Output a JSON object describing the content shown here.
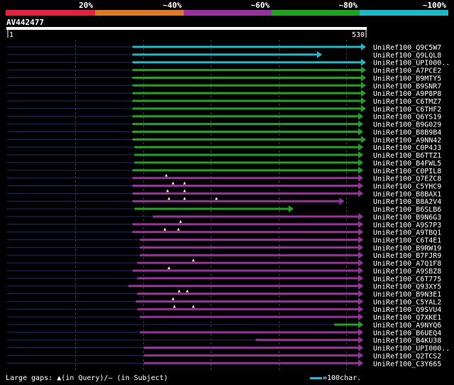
{
  "chart_data": {
    "type": "alignment-overview",
    "title": "AV442477",
    "query_length": 530,
    "query_ticks": [
      "1",
      "530"
    ],
    "identity_legend": [
      {
        "label": "20%",
        "color": "#e8213f"
      },
      {
        "label": "~40%",
        "color": "#e07a22"
      },
      {
        "label": "~60%",
        "color": "#9a2fa0"
      },
      {
        "label": "~80%",
        "color": "#1ea51e"
      },
      {
        "label": "~100%",
        "color": "#1cb8c8"
      }
    ],
    "hits": [
      {
        "name": "UniRef100_Q9C5W7",
        "start": 185,
        "end": 530,
        "color": "#1cb8c8",
        "gaps": []
      },
      {
        "name": "UniRef100_Q9LQL8",
        "start": 185,
        "end": 465,
        "color": "#1cb8c8",
        "gaps": []
      },
      {
        "name": "UniRef100_UPI000..",
        "start": 185,
        "end": 530,
        "color": "#1cb8c8",
        "gaps": []
      },
      {
        "name": "UniRef100_A7PCE2",
        "start": 185,
        "end": 530,
        "color": "#1ea51e",
        "gaps": []
      },
      {
        "name": "UniRef100_B9MTY5",
        "start": 185,
        "end": 530,
        "color": "#1ea51e",
        "gaps": []
      },
      {
        "name": "UniRef100_B9SNR7",
        "start": 185,
        "end": 530,
        "color": "#1ea51e",
        "gaps": []
      },
      {
        "name": "UniRef100_A9P8P8",
        "start": 185,
        "end": 530,
        "color": "#1ea51e",
        "gaps": []
      },
      {
        "name": "UniRef100_C6TMZ7",
        "start": 185,
        "end": 530,
        "color": "#1ea51e",
        "gaps": []
      },
      {
        "name": "UniRef100_C6THF2",
        "start": 185,
        "end": 530,
        "color": "#1ea51e",
        "gaps": []
      },
      {
        "name": "UniRef100_Q6YS19",
        "start": 185,
        "end": 526,
        "color": "#1ea51e",
        "gaps": []
      },
      {
        "name": "UniRef100_B9G029",
        "start": 185,
        "end": 526,
        "color": "#1ea51e",
        "gaps": []
      },
      {
        "name": "UniRef100_B8B9B4",
        "start": 185,
        "end": 526,
        "color": "#1ea51e",
        "gaps": []
      },
      {
        "name": "UniRef100_A9NN42",
        "start": 185,
        "end": 530,
        "color": "#1ea51e",
        "gaps": []
      },
      {
        "name": "UniRef100_C0P4J3",
        "start": 188,
        "end": 526,
        "color": "#1ea51e",
        "gaps": []
      },
      {
        "name": "UniRef100_B6TTZ1",
        "start": 188,
        "end": 526,
        "color": "#1ea51e",
        "gaps": []
      },
      {
        "name": "UniRef100_B4FWL5",
        "start": 188,
        "end": 526,
        "color": "#1ea51e",
        "gaps": []
      },
      {
        "name": "UniRef100_C0PIL8",
        "start": 185,
        "end": 526,
        "color": "#1ea51e",
        "gaps": []
      },
      {
        "name": "UniRef100_Q7EZC8",
        "start": 185,
        "end": 526,
        "color": "#9a2fa0",
        "gaps": [
          235
        ]
      },
      {
        "name": "UniRef100_C5YHC9",
        "start": 185,
        "end": 526,
        "color": "#9a2fa0",
        "gaps": [
          245,
          262
        ]
      },
      {
        "name": "UniRef100_B8BAX1",
        "start": 185,
        "end": 526,
        "color": "#9a2fa0",
        "gaps": [
          237,
          262
        ]
      },
      {
        "name": "UniRef100_B8A2V4",
        "start": 185,
        "end": 498,
        "color": "#9a2fa0",
        "gaps": [
          239,
          262,
          309
        ]
      },
      {
        "name": "UniRef100_B6SLB6",
        "start": 188,
        "end": 423,
        "color": "#1ea51e",
        "gaps": []
      },
      {
        "name": "UniRef100_B9N6G3",
        "start": 215,
        "end": 526,
        "color": "#9a2fa0",
        "gaps": []
      },
      {
        "name": "UniRef100_A9S7P3",
        "start": 185,
        "end": 526,
        "color": "#9a2fa0",
        "gaps": [
          256
        ]
      },
      {
        "name": "UniRef100_A9TBQ1",
        "start": 185,
        "end": 526,
        "color": "#9a2fa0",
        "gaps": [
          233,
          253
        ]
      },
      {
        "name": "UniRef100_C6T4E1",
        "start": 196,
        "end": 526,
        "color": "#9a2fa0",
        "gaps": []
      },
      {
        "name": "UniRef100_B9RW19",
        "start": 196,
        "end": 526,
        "color": "#9a2fa0",
        "gaps": []
      },
      {
        "name": "UniRef100_B7FJR9",
        "start": 196,
        "end": 526,
        "color": "#9a2fa0",
        "gaps": []
      },
      {
        "name": "UniRef100_A7Q1F8",
        "start": 192,
        "end": 526,
        "color": "#9a2fa0",
        "gaps": [
          275
        ]
      },
      {
        "name": "UniRef100_A9SBZ8",
        "start": 185,
        "end": 526,
        "color": "#9a2fa0",
        "gaps": [
          239
        ]
      },
      {
        "name": "UniRef100_C6T775",
        "start": 192,
        "end": 526,
        "color": "#9a2fa0",
        "gaps": []
      },
      {
        "name": "UniRef100_Q93XY5",
        "start": 179,
        "end": 526,
        "color": "#9a2fa0",
        "gaps": []
      },
      {
        "name": "UniRef100_B9N3E1",
        "start": 192,
        "end": 526,
        "color": "#9a2fa0",
        "gaps": [
          254,
          266
        ]
      },
      {
        "name": "UniRef100_C5YAL2",
        "start": 190,
        "end": 526,
        "color": "#9a2fa0",
        "gaps": [
          245
        ]
      },
      {
        "name": "UniRef100_Q9SVU4",
        "start": 192,
        "end": 526,
        "color": "#9a2fa0",
        "gaps": [
          247,
          275
        ]
      },
      {
        "name": "UniRef100_Q7XKE1",
        "start": 196,
        "end": 526,
        "color": "#9a2fa0",
        "gaps": []
      },
      {
        "name": "UniRef100_A9NYQ6",
        "start": 483,
        "end": 526,
        "color": "#1ea51e",
        "gaps": []
      },
      {
        "name": "UniRef100_B6UEQ4",
        "start": 196,
        "end": 526,
        "color": "#9a2fa0",
        "gaps": []
      },
      {
        "name": "UniRef100_B4KU38",
        "start": 367,
        "end": 526,
        "color": "#9a2fa0",
        "gaps": []
      },
      {
        "name": "UniRef100_UPI000..",
        "start": 202,
        "end": 526,
        "color": "#9a2fa0",
        "gaps": []
      },
      {
        "name": "UniRef100_Q2TCS2",
        "start": 202,
        "end": 526,
        "color": "#9a2fa0",
        "gaps": []
      },
      {
        "name": "UniRef100_C3Y665",
        "start": 202,
        "end": 526,
        "color": "#9a2fa0",
        "gaps": []
      }
    ],
    "footer": {
      "gaps_label": "Large gaps: ▲(in Query)/– (in Subject)",
      "scale_label": "=100char."
    }
  }
}
